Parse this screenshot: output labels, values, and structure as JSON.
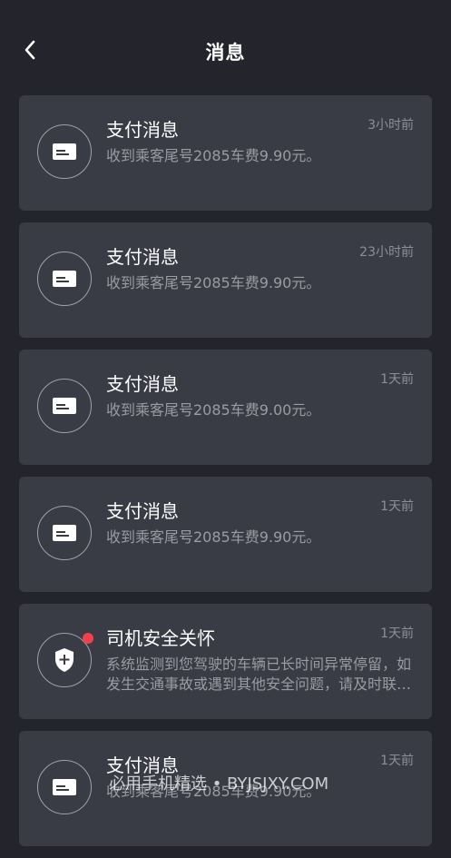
{
  "header": {
    "title": "消息",
    "back_icon": "chevron-left-icon"
  },
  "messages": [
    {
      "type": "payment",
      "icon": "payment-card-icon",
      "title": "支付消息",
      "time": "3小时前",
      "body": "收到乘客尾号2085车费9.90元。",
      "unread": false
    },
    {
      "type": "payment",
      "icon": "payment-card-icon",
      "title": "支付消息",
      "time": "23小时前",
      "body": "收到乘客尾号2085车费9.90元。",
      "unread": false
    },
    {
      "type": "payment",
      "icon": "payment-card-icon",
      "title": "支付消息",
      "time": "1天前",
      "body": "收到乘客尾号2085车费9.00元。",
      "unread": false
    },
    {
      "type": "payment",
      "icon": "payment-card-icon",
      "title": "支付消息",
      "time": "1天前",
      "body": "收到乘客尾号2085车费9.90元。",
      "unread": false
    },
    {
      "type": "safety",
      "icon": "shield-plus-icon",
      "title": "司机安全关怀",
      "time": "1天前",
      "body": "系统监测到您驾驶的车辆已长时间异常停留，如发生交通事故或遇到其他安全问题，请及时联系客服。",
      "unread": true
    },
    {
      "type": "payment",
      "icon": "payment-card-icon",
      "title": "支付消息",
      "time": "1天前",
      "body": "收到乘客尾号2085车费9.90元。",
      "unread": false
    }
  ],
  "watermark": "必用手机精选 • BYJSJXY.COM",
  "colors": {
    "background": "#24252c",
    "card": "#393b45",
    "unread_dot": "#f2404e"
  }
}
